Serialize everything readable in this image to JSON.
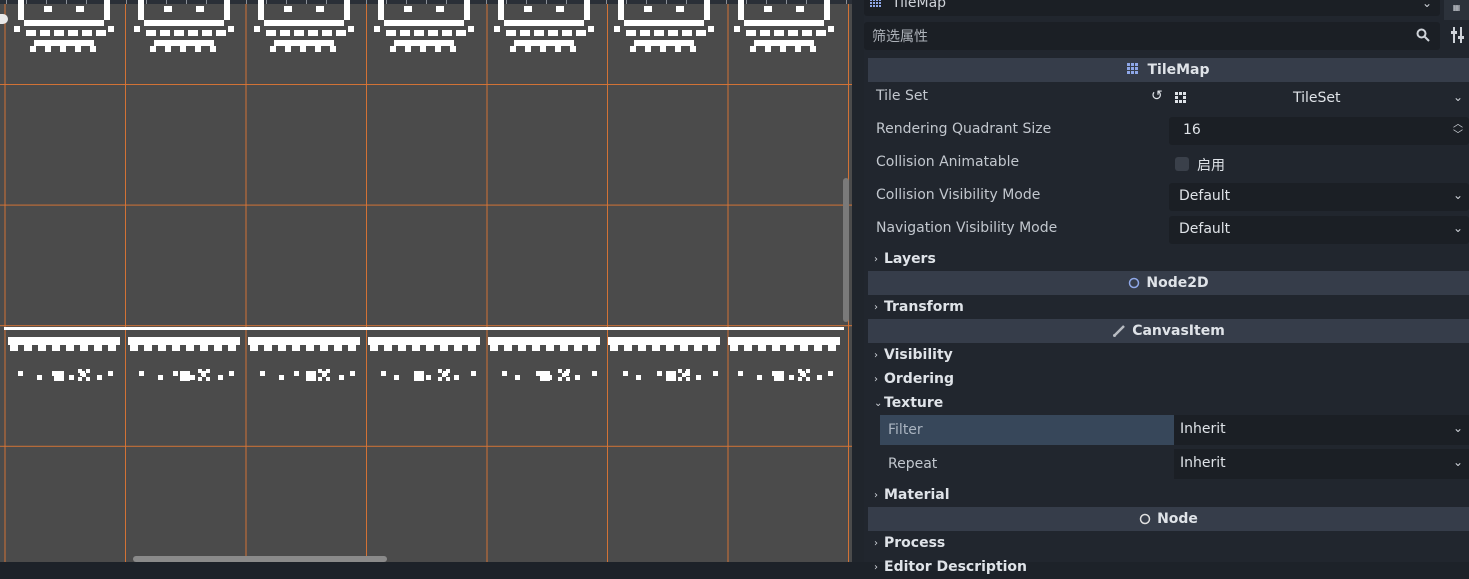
{
  "inspector": {
    "node_type": "TileMap",
    "filter_placeholder": "筛选属性",
    "categories": {
      "tilemap": "TileMap",
      "node2d": "Node2D",
      "canvasitem": "CanvasItem",
      "node": "Node"
    },
    "properties": {
      "tile_set": {
        "label": "Tile Set",
        "value": "TileSet"
      },
      "rendering_quadrant_size": {
        "label": "Rendering Quadrant Size",
        "value": "16"
      },
      "collision_animatable": {
        "label": "Collision Animatable",
        "value": "启用"
      },
      "collision_visibility_mode": {
        "label": "Collision Visibility Mode",
        "value": "Default"
      },
      "navigation_visibility_mode": {
        "label": "Navigation Visibility Mode",
        "value": "Default"
      }
    },
    "sections": {
      "layers": "Layers",
      "transform": "Transform",
      "visibility": "Visibility",
      "ordering": "Ordering",
      "texture": "Texture",
      "material": "Material",
      "process": "Process",
      "editor_description": "Editor Description"
    },
    "texture_props": {
      "filter": {
        "label": "Filter",
        "value": "Inherit"
      },
      "repeat": {
        "label": "Repeat",
        "value": "Inherit"
      }
    }
  },
  "colors": {
    "grid_line": "#d97434",
    "viewport_bg": "#4b4b4b",
    "selected_row": "#37475a",
    "category_bg": "#363d4a"
  }
}
